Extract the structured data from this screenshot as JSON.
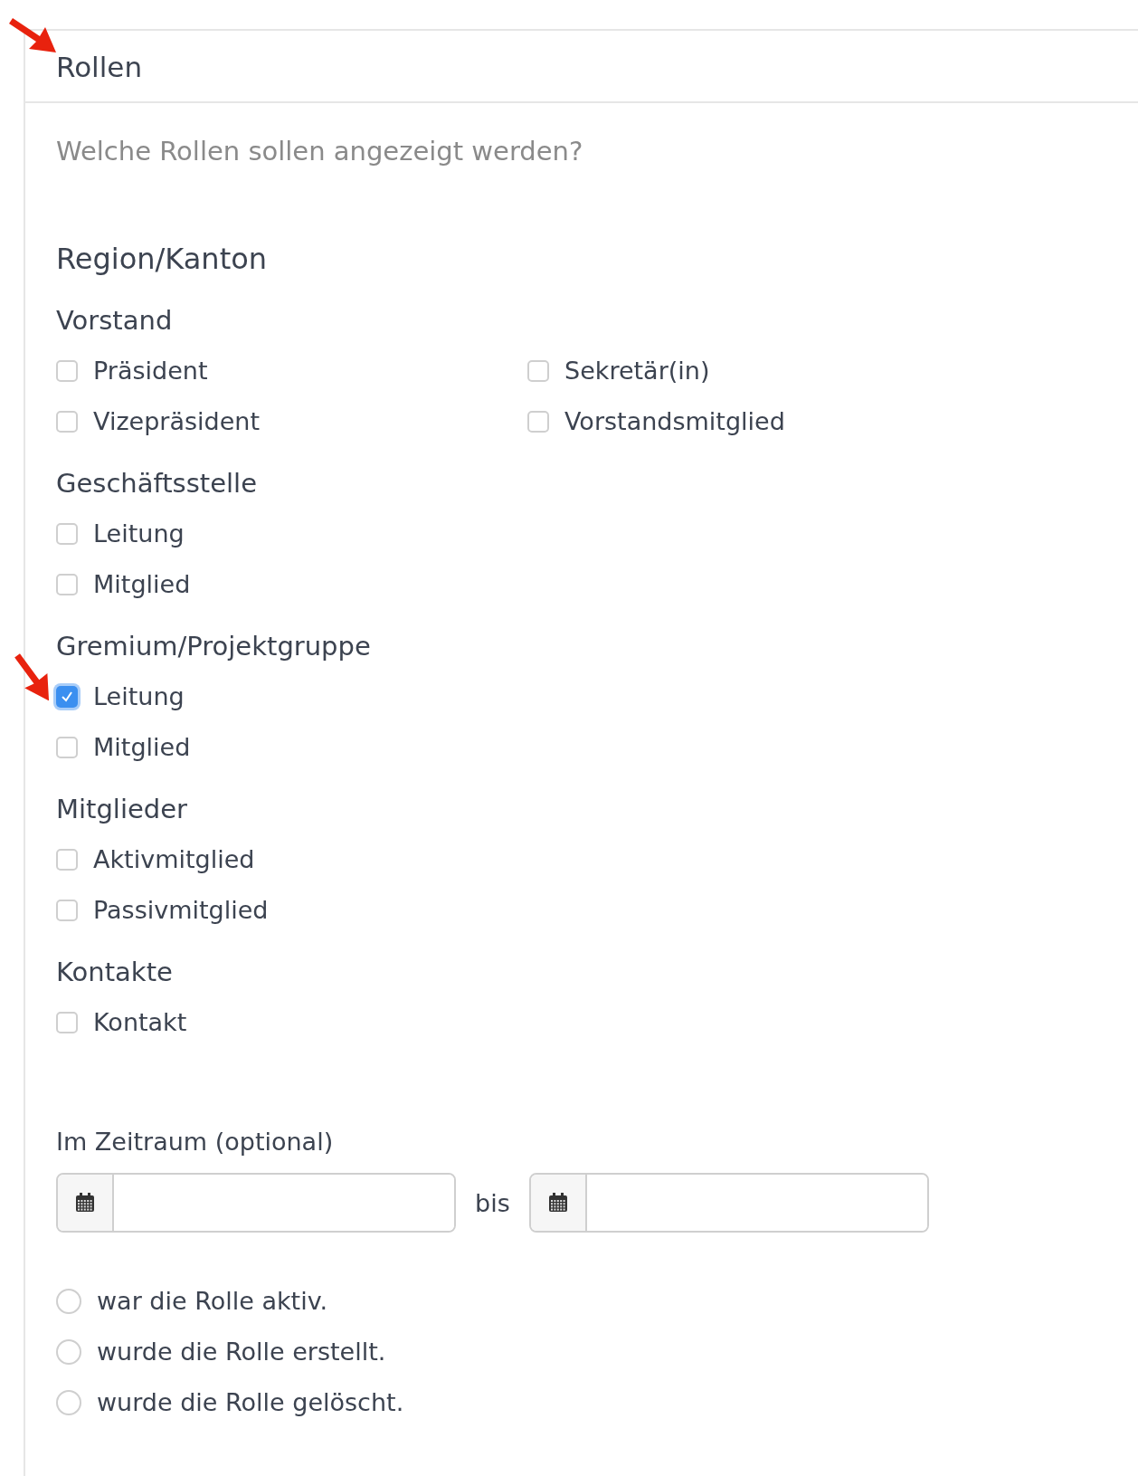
{
  "panel": {
    "title": "Rollen",
    "question": "Welche Rollen sollen angezeigt werden?"
  },
  "section": {
    "title": "Region/Kanton",
    "groups": [
      {
        "title": "Vorstand",
        "columns": [
          [
            {
              "label": "Präsident",
              "checked": false
            },
            {
              "label": "Vizepräsident",
              "checked": false
            }
          ],
          [
            {
              "label": "Sekretär(in)",
              "checked": false
            },
            {
              "label": "Vorstandsmitglied",
              "checked": false
            }
          ]
        ]
      },
      {
        "title": "Geschäftsstelle",
        "columns": [
          [
            {
              "label": "Leitung",
              "checked": false
            },
            {
              "label": "Mitglied",
              "checked": false
            }
          ]
        ]
      },
      {
        "title": "Gremium/Projektgruppe",
        "columns": [
          [
            {
              "label": "Leitung",
              "checked": true
            },
            {
              "label": "Mitglied",
              "checked": false
            }
          ]
        ]
      },
      {
        "title": "Mitglieder",
        "columns": [
          [
            {
              "label": "Aktivmitglied",
              "checked": false
            },
            {
              "label": "Passivmitglied",
              "checked": false
            }
          ]
        ]
      },
      {
        "title": "Kontakte",
        "columns": [
          [
            {
              "label": "Kontakt",
              "checked": false
            }
          ]
        ]
      }
    ]
  },
  "period": {
    "label": "Im Zeitraum (optional)",
    "separator": "bis",
    "options": [
      {
        "label": "war die Rolle aktiv.",
        "selected": false
      },
      {
        "label": "wurde die Rolle erstellt.",
        "selected": false
      },
      {
        "label": "wurde die Rolle gelöscht.",
        "selected": false
      }
    ]
  }
}
